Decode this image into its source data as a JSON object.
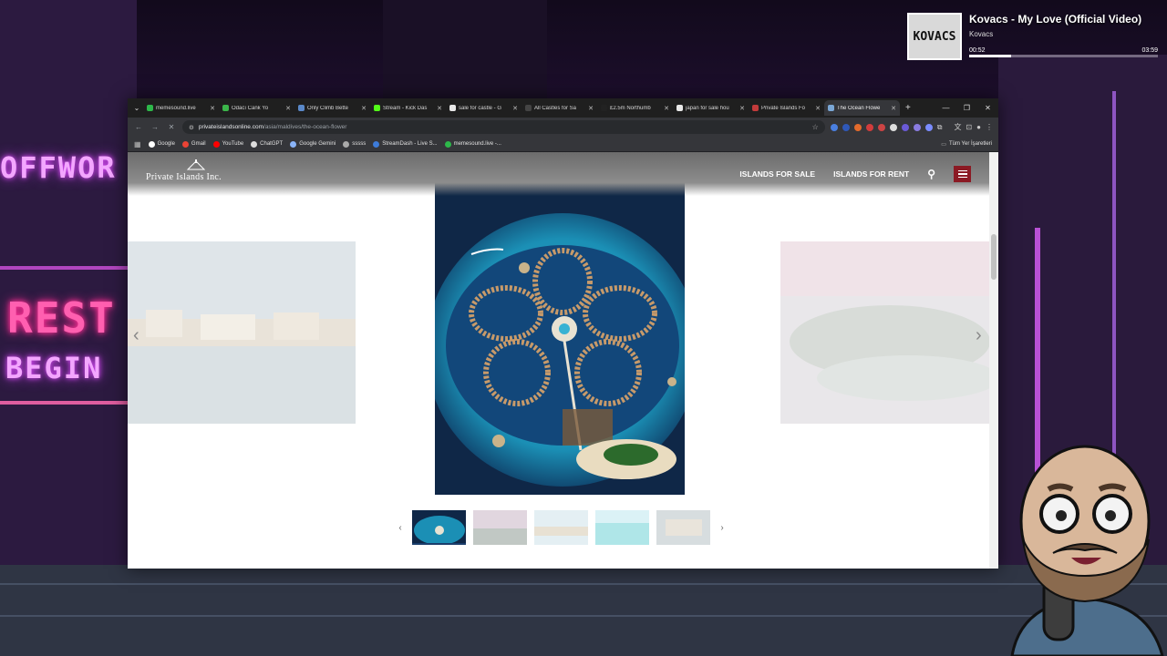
{
  "now_playing": {
    "title": "Kovacs - My Love (Official Video)",
    "artist": "Kovacs",
    "elapsed": "00:52",
    "duration": "03:59",
    "progress": 0.22,
    "album_text": "KOVACS"
  },
  "background": {
    "neon_top": "OFFWOR",
    "neon_mid": "REST",
    "neon_low": "BEGIN"
  },
  "browser": {
    "tabs": [
      {
        "label": "memesound.live",
        "color": "#2db84a",
        "active": false
      },
      {
        "label": "Odacı Cank Yo",
        "color": "#3bb54a",
        "active": false
      },
      {
        "label": "Only Climb Bette",
        "color": "#5a88c9",
        "active": false
      },
      {
        "label": "Stream - Kick Das",
        "color": "#53fc18",
        "active": false
      },
      {
        "label": "sale for castle - G",
        "color": "#e8e8e8",
        "active": false
      },
      {
        "label": "All Castles for Sa",
        "color": "#444444",
        "active": false
      },
      {
        "label": "£2.5m Northumb",
        "color": "#222222",
        "active": false
      },
      {
        "label": "japan for sale hou",
        "color": "#e8e8e8",
        "active": false
      },
      {
        "label": "Private Islands Fo",
        "color": "#c23b3b",
        "active": false
      },
      {
        "label": "The Ocean Flowe",
        "color": "#7aa7d6",
        "active": true
      }
    ],
    "new_tab": "+",
    "url_host": "privateislandsonline.com",
    "url_path": "/asia/maldives/the-ocean-flower",
    "bookmarks": [
      {
        "label": "Google",
        "color": "#ffffff"
      },
      {
        "label": "Gmail",
        "color": "#ea4335"
      },
      {
        "label": "YouTube",
        "color": "#ff0000"
      },
      {
        "label": "ChatGPT",
        "color": "#dddddd"
      },
      {
        "label": "Google Gemini",
        "color": "#8ab4f8"
      },
      {
        "label": "sssss",
        "color": "#aaaaaa"
      },
      {
        "label": "StreamDash - Live S...",
        "color": "#3d7bd9"
      },
      {
        "label": "memesound.live -...",
        "color": "#2db84a"
      }
    ],
    "all_bookmarks": "Tüm Yer İşaretleri"
  },
  "site": {
    "logo": "Private Islands Inc.",
    "nav": [
      "ISLANDS FOR SALE",
      "ISLANDS FOR RENT"
    ],
    "accent": "#8b1a24"
  },
  "gallery": {
    "prev_arrow": "‹",
    "next_arrow": "›",
    "thumbnails": 5,
    "active_index": 0
  }
}
